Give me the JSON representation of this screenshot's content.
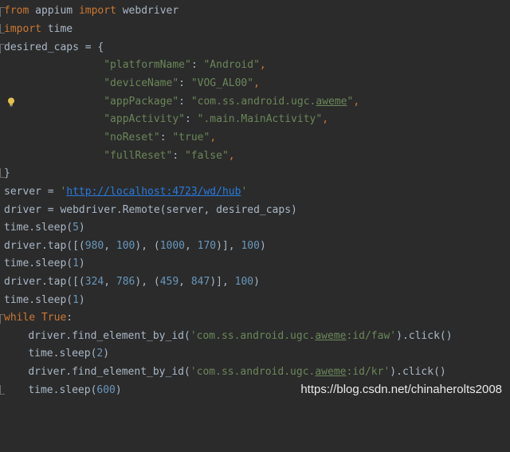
{
  "editor": {
    "lines": [
      {
        "id": 1,
        "kw1": "from",
        "t1": " appium ",
        "kw2": "import",
        "t2": " webdriver"
      },
      {
        "id": 2,
        "kw1": "import",
        "t1": " time"
      },
      {
        "id": 3,
        "t1": "desired_caps = {"
      },
      {
        "id": 4,
        "indent": "                ",
        "key": "\"platformName\"",
        "sep": ": ",
        "val": "\"Android\"",
        "tail": ","
      },
      {
        "id": 5,
        "indent": "                ",
        "key": "\"deviceName\"",
        "sep": ": ",
        "val": "\"VOG_AL00\"",
        "tail": ","
      },
      {
        "id": 6,
        "indent": "                ",
        "key": "\"appPackage\"",
        "sep": ": ",
        "val_a": "\"com.ss.android.ugc.",
        "val_u": "aweme",
        "val_b": "\"",
        "tail": ","
      },
      {
        "id": 7,
        "indent": "                ",
        "key": "\"appActivity\"",
        "sep": ": ",
        "val": "\".main.MainActivity\"",
        "tail": ","
      },
      {
        "id": 8,
        "indent": "                ",
        "key": "\"noReset\"",
        "sep": ": ",
        "val": "\"true\"",
        "tail": ","
      },
      {
        "id": 9,
        "indent": "                ",
        "key": "\"fullReset\"",
        "sep": ": ",
        "val": "\"false\"",
        "tail": ","
      },
      {
        "id": 10,
        "t1": "}"
      },
      {
        "id": 11,
        "t1": "server = ",
        "s1": "'",
        "link": "http://localhost:4723/wd/hub",
        "s2": "'"
      },
      {
        "id": 12,
        "t1": "driver = webdriver.Remote(server, desired_caps)"
      },
      {
        "id": 13,
        "t1": "time.sleep(",
        "n1": "5",
        "t2": ")"
      },
      {
        "id": 14,
        "t1": "driver.tap([(",
        "n1": "980",
        "t2": ", ",
        "n2": "100",
        "t3": "), (",
        "n3": "1000",
        "t4": ", ",
        "n4": "170",
        "t5": ")], ",
        "n5": "100",
        "t6": ")"
      },
      {
        "id": 15,
        "t1": "time.sleep(",
        "n1": "1",
        "t2": ")"
      },
      {
        "id": 16,
        "t1": "driver.tap([(",
        "n1": "324",
        "t2": ", ",
        "n2": "786",
        "t3": "), (",
        "n3": "459",
        "t4": ", ",
        "n4": "847",
        "t5": ")], ",
        "n5": "100",
        "t6": ")"
      },
      {
        "id": 17,
        "t1": "time.sleep(",
        "n1": "1",
        "t2": ")"
      },
      {
        "id": 18,
        "kw1": "while",
        "t1": " ",
        "kw2": "True",
        "t2": ":"
      },
      {
        "id": 19,
        "indent": "    ",
        "t1": "driver.find_element_by_id(",
        "s_a": "'com.ss.android.ugc.",
        "s_u": "aweme",
        "s_b": ":id/faw'",
        "t2": ").click()"
      },
      {
        "id": 20,
        "indent": "    ",
        "t1": "time.sleep(",
        "n1": "2",
        "t2": ")"
      },
      {
        "id": 21,
        "indent": "    ",
        "t1": "driver.find_element_by_id(",
        "s_a": "'com.ss.android.ugc.",
        "s_u": "aweme",
        "s_b": ":id/kr'",
        "t2": ").click()"
      },
      {
        "id": 22,
        "indent": "    ",
        "t1": "time.sleep(",
        "n1": "600",
        "t2": ")"
      }
    ]
  },
  "watermark": "https://blog.csdn.net/chinaherolts2008",
  "colors": {
    "background": "#2b2b2b",
    "keyword": "#cc7832",
    "string": "#6a8759",
    "number": "#6897bb",
    "text": "#a9b7c6",
    "link": "#287bde"
  },
  "icons": [
    "fold-marker-icon",
    "lightbulb-icon"
  ]
}
